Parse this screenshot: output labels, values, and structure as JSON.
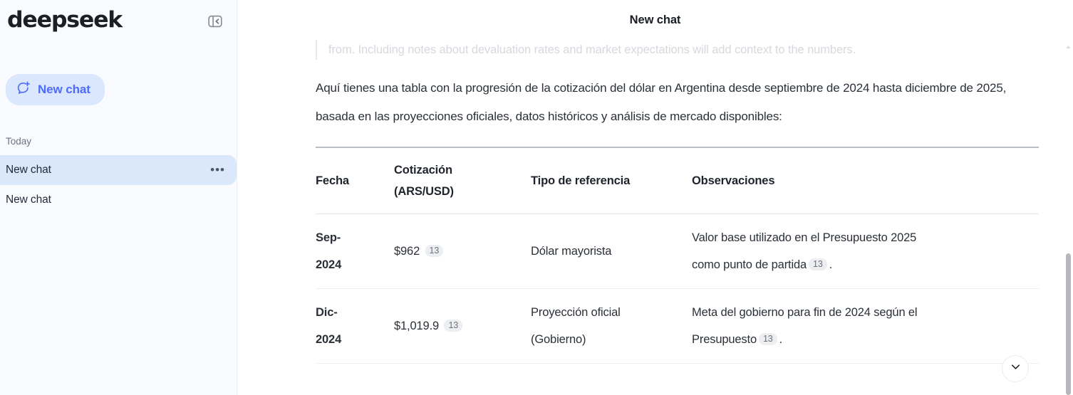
{
  "sidebar": {
    "logo": "deepseek",
    "collapse_icon": "sidebar-collapse-icon",
    "new_chat": {
      "label": "New chat",
      "icon": "chat-plus-icon",
      "bg_color": "#dbe7fd",
      "text_color": "#4d6bfe"
    },
    "section_label": "Today",
    "chats": [
      {
        "title": "New chat",
        "active": true,
        "menu": "•••"
      },
      {
        "title": "New chat",
        "active": false,
        "menu": ""
      }
    ]
  },
  "header": {
    "title": "New chat"
  },
  "main": {
    "faded_quote": "from. Including notes about devaluation rates and market expectations will add context to the numbers.",
    "paragraph": "Aquí tienes una tabla con la progresión de la cotización del dólar en Argentina desde septiembre de 2024 hasta diciembre de 2025, basada en las proyecciones oficiales, datos históricos y análisis de mercado disponibles:",
    "table": {
      "headers": [
        "Fecha",
        "Cotización (ARS/USD)",
        "Tipo de referencia",
        "Observaciones"
      ],
      "header_cotizacion_line1": "Cotización",
      "header_cotizacion_line2": "(ARS/USD)",
      "rows": [
        {
          "fecha_line1": "Sep-",
          "fecha_line2": "2024",
          "cotizacion": "$962",
          "cotizacion_cite": "13",
          "tipo_line1": "Dólar mayorista",
          "tipo_line2": "",
          "obs_line1": "Valor base utilizado en el Presupuesto 2025",
          "obs_line2": "como punto de partida",
          "obs_cite": "13",
          "obs_tail": "."
        },
        {
          "fecha_line1": "Dic-",
          "fecha_line2": "2024",
          "cotizacion": "$1,019.9",
          "cotizacion_cite": "13",
          "tipo_line1": "Proyección oficial",
          "tipo_line2": "(Gobierno)",
          "obs_line1": "Meta del gobierno para fin de 2024 según el",
          "obs_line2": "Presupuesto",
          "obs_cite": "13",
          "obs_tail": "."
        }
      ]
    },
    "scroll_button_icon": "chevron-down-icon"
  }
}
